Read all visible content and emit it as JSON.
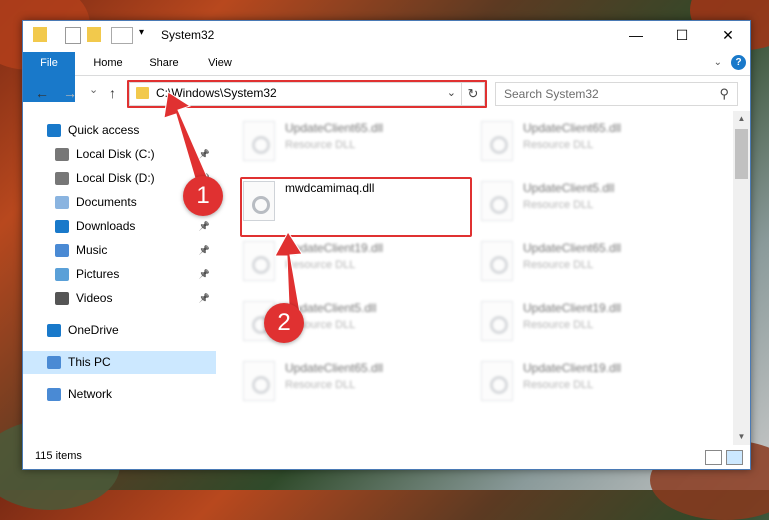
{
  "window": {
    "title": "System32",
    "controls": {
      "minimize": "—",
      "maximize": "☐",
      "close": "✕"
    }
  },
  "ribbon": {
    "tabs": [
      {
        "label": "File"
      },
      {
        "label": "Home"
      },
      {
        "label": "Share"
      },
      {
        "label": "View"
      }
    ],
    "help": "?"
  },
  "nav": {
    "back": "←",
    "forward": "→",
    "recent": "⌄",
    "up": "↑",
    "address": "C:\\Windows\\System32",
    "search_placeholder": "Search System32"
  },
  "sidebar": {
    "items": [
      {
        "label": "Quick access",
        "icon": "star-icon",
        "pinned": false
      },
      {
        "label": "Local Disk (C:)",
        "icon": "drive-icon",
        "pinned": true
      },
      {
        "label": "Local Disk (D:)",
        "icon": "drive-icon",
        "pinned": true
      },
      {
        "label": "Documents",
        "icon": "documents-icon",
        "pinned": true
      },
      {
        "label": "Downloads",
        "icon": "download-icon",
        "pinned": true
      },
      {
        "label": "Music",
        "icon": "music-icon",
        "pinned": true
      },
      {
        "label": "Pictures",
        "icon": "pictures-icon",
        "pinned": true
      },
      {
        "label": "Videos",
        "icon": "videos-icon",
        "pinned": true
      },
      {
        "label": "OneDrive",
        "icon": "onedrive-icon",
        "pinned": false
      },
      {
        "label": "This PC",
        "icon": "computer-icon",
        "pinned": false,
        "selected": true
      },
      {
        "label": "Network",
        "icon": "network-icon",
        "pinned": false
      }
    ]
  },
  "files": [
    {
      "name": "UpdateClient65.dll",
      "type": "Resource DLL"
    },
    {
      "name": "UpdateClient65.dll",
      "type": "Resource DLL"
    },
    {
      "name": "mwdcamimaq.dll",
      "type": ""
    },
    {
      "name": "UpdateClient5.dll",
      "type": "Resource DLL"
    },
    {
      "name": "UpdateClient19.dll",
      "type": "Resource DLL"
    },
    {
      "name": "UpdateClient65.dll",
      "type": "Resource DLL"
    },
    {
      "name": "UpdateClient5.dll",
      "type": "Resource DLL"
    },
    {
      "name": "UpdateClient19.dll",
      "type": "Resource DLL"
    },
    {
      "name": "UpdateClient65.dll",
      "type": "Resource DLL"
    },
    {
      "name": "UpdateClient19.dll",
      "type": "Resource DLL"
    }
  ],
  "status": {
    "count": "115 items"
  },
  "annotations": {
    "step1": "1",
    "step2": "2",
    "color": "#e03131"
  },
  "colors": {
    "accent": "#1979ca",
    "selection": "#cce8ff"
  }
}
